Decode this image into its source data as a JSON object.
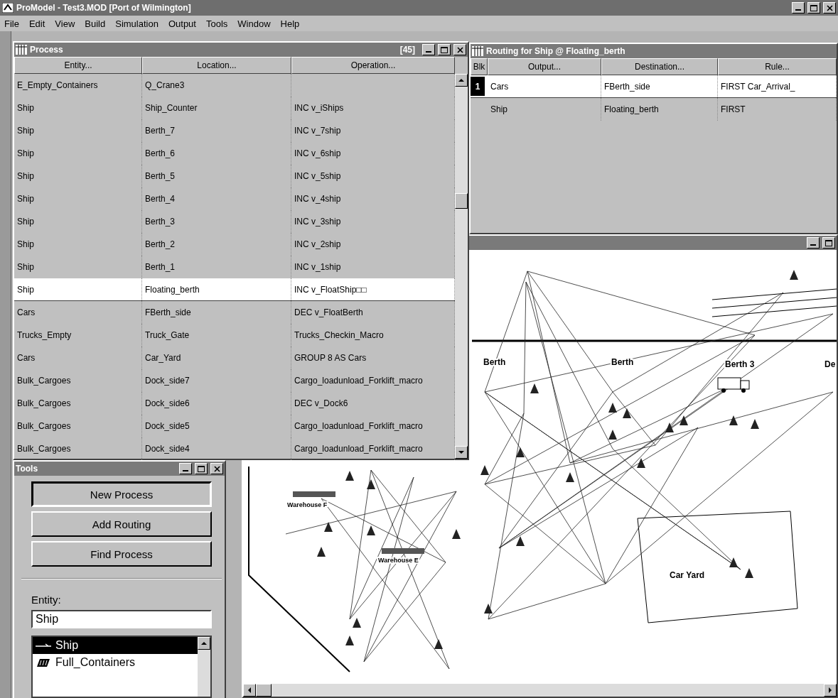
{
  "window": {
    "title": "ProModel - Test3.MOD [Port of Wilmington]"
  },
  "menu": [
    "File",
    "Edit",
    "View",
    "Build",
    "Simulation",
    "Output",
    "Tools",
    "Window",
    "Help"
  ],
  "process": {
    "title": "Process",
    "count": "[45]",
    "columns": [
      "Entity...",
      "Location...",
      "Operation..."
    ],
    "rows": [
      {
        "cells": [
          "E_Empty_Containers",
          "Q_Crane3",
          ""
        ],
        "selected": false
      },
      {
        "cells": [
          "Ship",
          "Ship_Counter",
          "INC v_iShips"
        ],
        "selected": false
      },
      {
        "cells": [
          "Ship",
          "Berth_7",
          "INC v_7ship"
        ],
        "selected": false
      },
      {
        "cells": [
          "Ship",
          "Berth_6",
          "INC v_6ship"
        ],
        "selected": false
      },
      {
        "cells": [
          "Ship",
          "Berth_5",
          "INC v_5ship"
        ],
        "selected": false
      },
      {
        "cells": [
          "Ship",
          "Berth_4",
          "INC v_4ship"
        ],
        "selected": false
      },
      {
        "cells": [
          "Ship",
          "Berth_3",
          "INC v_3ship"
        ],
        "selected": false
      },
      {
        "cells": [
          "Ship",
          "Berth_2",
          "INC v_2ship"
        ],
        "selected": false
      },
      {
        "cells": [
          "Ship",
          "Berth_1",
          "INC v_1ship"
        ],
        "selected": false
      },
      {
        "cells": [
          "Ship",
          "Floating_berth",
          "INC v_FloatShip□□"
        ],
        "selected": true
      },
      {
        "cells": [
          "Cars",
          "FBerth_side",
          "DEC v_FloatBerth"
        ],
        "selected": false
      },
      {
        "cells": [
          "Trucks_Empty",
          "Truck_Gate",
          "Trucks_Checkin_Macro"
        ],
        "selected": false
      },
      {
        "cells": [
          "Cars",
          "Car_Yard",
          "GROUP 8 AS Cars"
        ],
        "selected": false
      },
      {
        "cells": [
          "Bulk_Cargoes",
          "Dock_side7",
          "Cargo_loadunload_Forklift_macro"
        ],
        "selected": false
      },
      {
        "cells": [
          "Bulk_Cargoes",
          "Dock_side6",
          "DEC v_Dock6"
        ],
        "selected": false
      },
      {
        "cells": [
          "Bulk_Cargoes",
          "Dock_side5",
          "Cargo_loadunload_Forklift_macro"
        ],
        "selected": false
      },
      {
        "cells": [
          "Bulk_Cargoes",
          "Dock_side4",
          "Cargo_loadunload_Forklift_macro"
        ],
        "selected": false
      }
    ]
  },
  "routing": {
    "title": "Routing for Ship @ Floating_berth",
    "columns": [
      "Blk",
      "Output...",
      "Destination...",
      "Rule..."
    ],
    "rows": [
      {
        "block": "1",
        "cells": [
          "Cars",
          "FBerth_side",
          "FIRST Car_Arrival_"
        ],
        "selected": true
      },
      {
        "block": "",
        "cells": [
          "Ship",
          "Floating_berth",
          "FIRST"
        ],
        "selected": false
      }
    ]
  },
  "layout": {
    "labels": [
      "Berth",
      "Berth",
      "Berth 3",
      "De",
      "Warehouse F",
      "Warehouse E",
      "Car Yard"
    ]
  },
  "tools": {
    "title": "Tools",
    "buttons": [
      {
        "label": "New Process",
        "selected": true
      },
      {
        "label": "Add Routing",
        "selected": false
      },
      {
        "label": "Find Process",
        "selected": false
      }
    ],
    "entity_label": "Entity:",
    "entity_value": "Ship",
    "entity_list": [
      {
        "label": "Ship",
        "kind": "ship",
        "selected": true
      },
      {
        "label": "Full_Containers",
        "kind": "container",
        "selected": false
      }
    ]
  }
}
